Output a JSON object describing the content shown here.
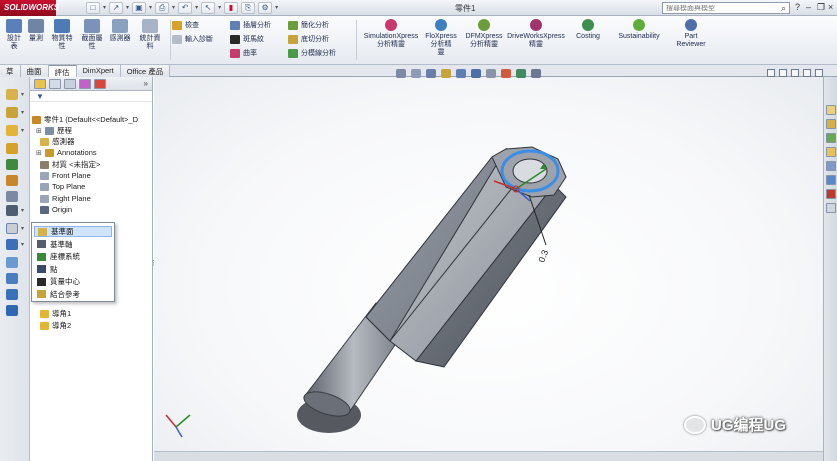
{
  "app": {
    "logo_text": "SOLIDWORKS",
    "doc_title": "零件1",
    "search_placeholder": "搜尋模面與模型"
  },
  "ribbon": {
    "large_buttons": [
      {
        "label": "設計\n表",
        "icon": "design-table-icon",
        "color": "#5b7fb8"
      },
      {
        "label": "量測",
        "icon": "measure-icon",
        "color": "#6e86a6"
      },
      {
        "label": "物質特\n性",
        "icon": "mass-properties-icon",
        "color": "#4c7bb5"
      },
      {
        "label": "截面屬\n性",
        "icon": "section-properties-icon",
        "color": "#7b93b9"
      },
      {
        "label": "感測器",
        "icon": "sensor-icon",
        "color": "#8aa1c0"
      },
      {
        "label": "統計資\n料",
        "icon": "statistics-icon",
        "color": "#a7b3c6"
      }
    ],
    "small_buttons": [
      {
        "label": "檢查",
        "icon": "check-icon",
        "color": "#d9a02a"
      },
      {
        "label": "輸入診斷",
        "icon": "import-diagnostics-icon",
        "color": "#b4bcc8"
      },
      {
        "label": "插層分析",
        "icon": "draft-analysis-icon",
        "color": "#5f7fb5"
      },
      {
        "label": "斑馬紋",
        "icon": "zebra-stripes-icon",
        "color": "#2a2a2a"
      },
      {
        "label": "曲率",
        "icon": "curvature-icon",
        "color": "#c5396b"
      },
      {
        "label": "簡化分析",
        "icon": "undercut-analysis-icon",
        "color": "#6a9e3a"
      },
      {
        "label": "底切分析",
        "icon": "parting-analysis-icon",
        "color": "#c8a33a"
      },
      {
        "label": "分模線分析",
        "icon": "parting-line-analysis-icon",
        "color": "#4a9a4a"
      }
    ],
    "xpress_buttons": [
      {
        "label": "SimulationXpress\n分析精靈",
        "icon": "simulationxpress-icon",
        "color": "#c9386a"
      },
      {
        "label": "FloXpress\n分析精\n靈",
        "icon": "floxpress-icon",
        "color": "#3f7fc0"
      },
      {
        "label": "DFMXpress\n分析精靈",
        "icon": "dfmxpress-icon",
        "color": "#6a9e3a"
      },
      {
        "label": "DriveWorksXpress\n精靈",
        "icon": "driveworksxpress-icon",
        "color": "#a0356b"
      },
      {
        "label": "Costing",
        "icon": "costing-icon",
        "color": "#3e8f4d"
      },
      {
        "label": "Sustainability",
        "icon": "sustainability-icon",
        "color": "#5fae3d"
      },
      {
        "label": "Part\nReviewer",
        "icon": "part-reviewer-icon",
        "color": "#4e6fa8"
      }
    ]
  },
  "tabs": [
    "草",
    "曲面",
    "評估",
    "DimXpert",
    "Office 產品"
  ],
  "active_tab": 2,
  "tree": [
    {
      "label": "零件1 (Default<<Default>_D",
      "icon": "part-icon",
      "color": "#c8872a"
    },
    {
      "label": "歷程",
      "icon": "history-icon",
      "color": "#7d8fa8",
      "expandable": true
    },
    {
      "label": "感測器",
      "icon": "sensor-folder-icon",
      "color": "#d6b34a"
    },
    {
      "label": "Annotations",
      "icon": "annotations-icon",
      "color": "#c89a2a",
      "expandable": true
    },
    {
      "label": "材質 <未指定>",
      "icon": "material-icon",
      "color": "#8a7f6b"
    },
    {
      "label": "Front Plane",
      "icon": "plane-icon",
      "color": "#9aa6b8"
    },
    {
      "label": "Top Plane",
      "icon": "plane-icon",
      "color": "#9aa6b8"
    },
    {
      "label": "Right Plane",
      "icon": "plane-icon",
      "color": "#9aa6b8"
    },
    {
      "label": "Origin",
      "icon": "origin-icon",
      "color": "#5a6780"
    },
    {
      "label": "導角1",
      "icon": "chamfer-icon",
      "color": "#e2b43a"
    },
    {
      "label": "導角2",
      "icon": "chamfer-icon",
      "color": "#e2b43a"
    }
  ],
  "ref_menu": [
    {
      "label": "基準面",
      "icon": "reference-plane-icon",
      "color": "#d6b34a"
    },
    {
      "label": "基準軸",
      "icon": "reference-axis-icon",
      "color": "#555c6b"
    },
    {
      "label": "座標系統",
      "icon": "coordinate-system-icon",
      "color": "#3a8a3a"
    },
    {
      "label": "點",
      "icon": "point-icon",
      "color": "#3a4a6a"
    },
    {
      "label": "質量中心",
      "icon": "center-of-mass-icon",
      "color": "#2a2a2a"
    },
    {
      "label": "結合參考",
      "icon": "mate-reference-icon",
      "color": "#c8a33a"
    }
  ],
  "model": {
    "label": "0.3",
    "cylinder_color": "#8a8f99",
    "edge_color": "#2f333a",
    "highlight_color": "#3b8ee6"
  },
  "watermark": "UG编程UG"
}
